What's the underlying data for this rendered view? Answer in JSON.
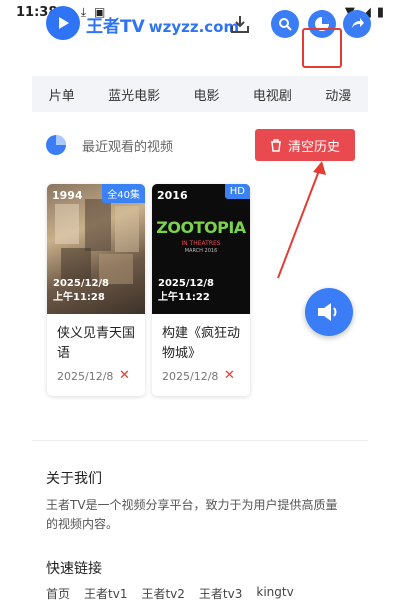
{
  "status_bar": {
    "time": "11:38"
  },
  "header": {
    "logo_name": "王者TV",
    "logo_domain": "wzyzz.com"
  },
  "nav": [
    "片单",
    "蓝光电影",
    "电影",
    "电视剧",
    "动漫"
  ],
  "history": {
    "title": "最近观看的视频",
    "clear_label": "清空历史",
    "items": [
      {
        "year": "1994",
        "tag": "全40集",
        "watched_date": "2025/12/8",
        "watched_time": "上午11:28",
        "title": "侠义见青天国语",
        "date": "2025/12/8"
      },
      {
        "year": "2016",
        "tag": "HD",
        "watched_date": "2025/12/8",
        "watched_time": "上午11:22",
        "title": "构建《疯狂动物城》",
        "date": "2025/12/8"
      }
    ]
  },
  "about": {
    "title": "关于我们",
    "desc": "王者TV是一个视频分享平台，致力于为用户提供高质量的视频内容。"
  },
  "quick_links": {
    "title": "快速链接",
    "items": [
      "首页",
      "王者tv1",
      "王者tv2",
      "王者tv3",
      "kingtv"
    ]
  },
  "poster2_text": {
    "brand": "ZOOTOPIA",
    "line1": "IN THEATRES",
    "line2": "MARCH 2016"
  },
  "colors": {
    "brand_blue": "#2f74f4",
    "danger_red": "#e84a4f",
    "tag_blue": "#3b82f6"
  }
}
